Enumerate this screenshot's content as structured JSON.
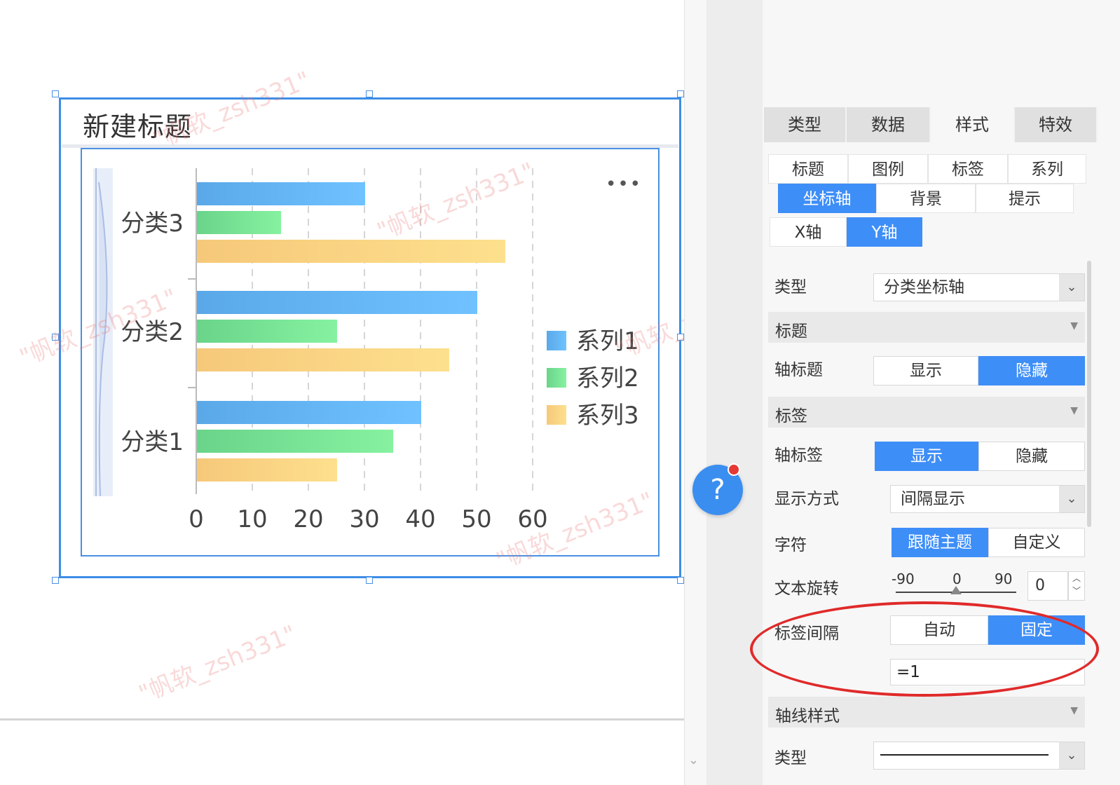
{
  "widget": {
    "title": "新建标题",
    "more_icon": "more-dots-icon"
  },
  "chart_data": {
    "type": "bar",
    "orientation": "horizontal",
    "categories": [
      "分类3",
      "分类2",
      "分类1"
    ],
    "series": [
      {
        "name": "系列1",
        "color": "#5aaef0",
        "values": [
          30,
          50,
          40
        ]
      },
      {
        "name": "系列2",
        "color": "#6fe08f",
        "values": [
          15,
          25,
          35
        ]
      },
      {
        "name": "系列3",
        "color": "#fbd178",
        "values": [
          55,
          45,
          25
        ]
      }
    ],
    "xlim": [
      0,
      60
    ],
    "xticks": [
      "0",
      "10",
      "20",
      "30",
      "40",
      "50",
      "60"
    ],
    "grid": "vertical-dashed",
    "legend_position": "right"
  },
  "watermark": "\"帆软_zsh331\"",
  "help": {
    "label": "?"
  },
  "panel": {
    "tabs": [
      {
        "label": "类型",
        "active": false
      },
      {
        "label": "数据",
        "active": false
      },
      {
        "label": "样式",
        "active": true
      },
      {
        "label": "特效",
        "active": false
      }
    ],
    "subtabs_row1": [
      "标题",
      "图例",
      "标签",
      "系列"
    ],
    "subtabs_row2": [
      "坐标轴",
      "背景",
      "提示"
    ],
    "axis_tabs": [
      "X轴",
      "Y轴"
    ],
    "type_label": "类型",
    "type_value": "分类坐标轴",
    "section_title": "标题",
    "axis_title_label": "轴标题",
    "show": "显示",
    "hide": "隐藏",
    "section_label": "标签",
    "axis_label_label": "轴标签",
    "display_mode_label": "显示方式",
    "display_mode_value": "间隔显示",
    "charset_label": "字符",
    "follow_theme": "跟随主题",
    "custom": "自定义",
    "rotate_label": "文本旋转",
    "rotate_ticks": [
      "-90",
      "0",
      "90"
    ],
    "rotate_value": "0",
    "interval_label": "标签间隔",
    "auto": "自动",
    "fixed": "固定",
    "interval_value": "=1",
    "section_axis_line": "轴线样式",
    "line_type_label": "类型"
  }
}
